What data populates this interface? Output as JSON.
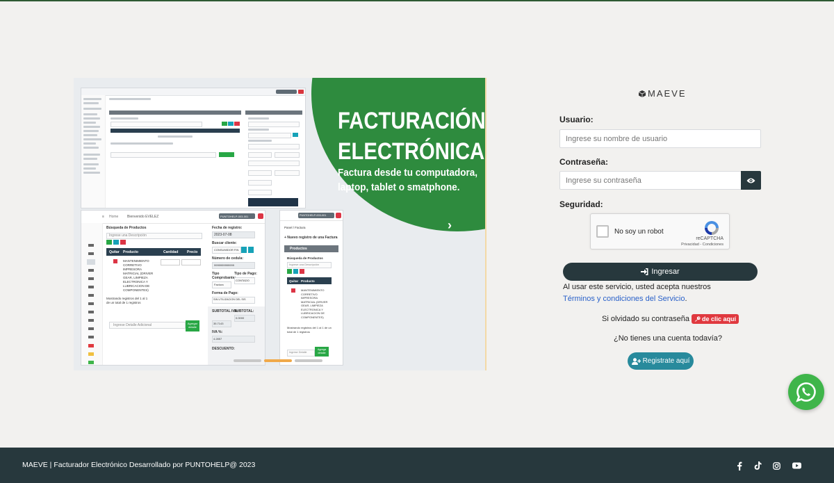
{
  "promo": {
    "title": "FACTURACIÓN\nELECTRÓNICA",
    "subtitle": "Factura desde tu computadora, laptop, tablet o smatphone.",
    "next_icon": "chevron-right-icon",
    "slides": 3,
    "active_slide": 2,
    "mock_mobile": {
      "section": "Búsqueda de Productos",
      "search_placeholder": "Ingrese una Descripción",
      "col_quitar": "Quitar",
      "col_producto": "Producto",
      "col_cantidad": "Cantidad",
      "col_precio": "Precio",
      "product": "MANTENIMIENTO CORRETIVO IMPRESORA MATRICIAL (DRIVER GEAR, LIMPIEZA ELECTRONICA Y LUBRICACION DE COMPONENTES)",
      "showing": "Mostrando registros del 1 al 1 de un total de 1 registros",
      "detail_placeholder": "Ingrese Detalle Adicional",
      "add_detail": "Agregar detalle",
      "fecha_label": "Fecha de registro:",
      "fecha_value": "2023-07-08",
      "buscar_label": "Buscar cliente:",
      "buscar_value": "CONSUMIDOR FIN",
      "cedula_label": "Número de cedula:",
      "cedula_value": "9999999999999",
      "tipo_label": "Tipo Comprobante:",
      "tipo_value": "Factura",
      "pago_label": "Tipo de Pago:",
      "pago_value": "CONTADO",
      "forma_label": "Forma de Pago:",
      "forma_value": "SIN UTILIZACION DEL SIS",
      "subtotal_iva": "SUBTOTAL IVA:",
      "subtotal_iva_value": "35.7143",
      "subtotal": "SUBTOTAL:",
      "subtotal_value": "0.0000",
      "iva": "IVA %:",
      "iva_value": "4.2857",
      "descuento": "DESCUENTO:",
      "home": "Home",
      "welcome": "Bienvenido EVELEZ",
      "badge": "PUNTOHELP-003-001"
    },
    "mock_tablet": {
      "breadcrumb": "Panel / Factura",
      "new": "+ Nuevo registro de una Factura",
      "products": "Productos",
      "search": "Búsqueda de Productos",
      "placeholder": "Ingrese una Descripción",
      "col_quitar": "Quitar",
      "col_producto": "Producto",
      "product": "MANTENIMIENTO CORRETIVO IMPRESORA MATRICIAL (DRIVER GEAR, LIMPIEZA ELECTRONICA Y LUBRICACION DE COMPONENTES)",
      "showing": "Mostrando registros del 1 al 1 de un total de 1 registros",
      "detail": "Ingrese Detalle",
      "add": "Agrega detalle",
      "badge": "PUNTOHELP-003-001"
    }
  },
  "login": {
    "logo_text": "MAEVE",
    "logo_icon": "cube-icon",
    "user_label": "Usuario:",
    "user_placeholder": "Ingrese su nombre de usuario",
    "user_value": "",
    "pass_label": "Contraseña:",
    "pass_placeholder": "Ingrese su contraseña",
    "pass_value": "",
    "eye_icon": "eye-icon",
    "security_label": "Seguridad:",
    "captcha_text": "No soy un robot",
    "captcha_brand": "reCAPTCHA",
    "captcha_links": "Privacidad - Condiciones",
    "login_button": "Ingresar",
    "login_icon": "sign-in-icon",
    "terms_prefix": "Al usar este servicio, usted acepta nuestros ",
    "terms_link": "Términos y condiciones del Servicio",
    "terms_suffix": ".",
    "forgot_text": "Si olvidado su contraseña",
    "forgot_badge": "de clic aquí",
    "forgot_icon": "key-icon",
    "no_account": "¿No tienes una cuenta todavía?",
    "register_button": "Registrate aquí",
    "register_icon": "user-plus-icon"
  },
  "whatsapp_icon": "whatsapp-icon",
  "footer": {
    "text": "MAEVE | Facturador Electrónico Desarrollado por PUNTOHELP@ 2023",
    "social": [
      "facebook-icon",
      "tiktok-icon",
      "instagram-icon",
      "youtube-icon"
    ]
  },
  "colors": {
    "background": "#f2f1ef",
    "dark": "#27383d",
    "promo_green": "#2e8b3e",
    "link": "#2a61c9",
    "danger": "#e0393f",
    "teal": "#288a9c",
    "whatsapp": "#3fb54a"
  }
}
